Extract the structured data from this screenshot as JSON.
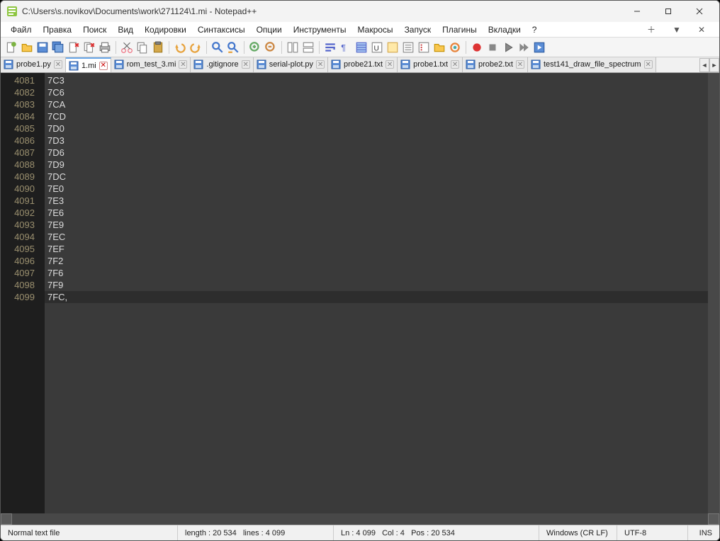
{
  "title": "C:\\Users\\s.novikov\\Documents\\work\\271124\\1.mi - Notepad++",
  "menu": {
    "file": "Файл",
    "edit": "Правка",
    "search": "Поиск",
    "view": "Вид",
    "encoding": "Кодировки",
    "syntax": "Синтаксисы",
    "settings": "Опции",
    "tools": "Инструменты",
    "macros": "Макросы",
    "run": "Запуск",
    "plugins": "Плагины",
    "tabs": "Вкладки",
    "help": "?"
  },
  "tabs": [
    {
      "label": "probe1.py"
    },
    {
      "label": "1.mi"
    },
    {
      "label": "rom_test_3.mi"
    },
    {
      "label": ".gitignore"
    },
    {
      "label": "serial-plot.py"
    },
    {
      "label": "probe21.txt"
    },
    {
      "label": "probe1.txt"
    },
    {
      "label": "probe2.txt"
    },
    {
      "label": "test141_draw_file_spectrum"
    }
  ],
  "active_tab_index": 1,
  "lines": [
    {
      "n": "4081",
      "t": "7C3"
    },
    {
      "n": "4082",
      "t": "7C6"
    },
    {
      "n": "4083",
      "t": "7CA"
    },
    {
      "n": "4084",
      "t": "7CD"
    },
    {
      "n": "4085",
      "t": "7D0"
    },
    {
      "n": "4086",
      "t": "7D3"
    },
    {
      "n": "4087",
      "t": "7D6"
    },
    {
      "n": "4088",
      "t": "7D9"
    },
    {
      "n": "4089",
      "t": "7DC"
    },
    {
      "n": "4090",
      "t": "7E0"
    },
    {
      "n": "4091",
      "t": "7E3"
    },
    {
      "n": "4092",
      "t": "7E6"
    },
    {
      "n": "4093",
      "t": "7E9"
    },
    {
      "n": "4094",
      "t": "7EC"
    },
    {
      "n": "4095",
      "t": "7EF"
    },
    {
      "n": "4096",
      "t": "7F2"
    },
    {
      "n": "4097",
      "t": "7F6"
    },
    {
      "n": "4098",
      "t": "7F9"
    },
    {
      "n": "4099",
      "t": "7FC,"
    }
  ],
  "current_line_index": 18,
  "status": {
    "filetype": "Normal text file",
    "length_label": "length : 20 534",
    "lines_label": "lines : 4 099",
    "ln_label": "Ln : 4 099",
    "col_label": "Col : 4",
    "pos_label": "Pos : 20 534",
    "eol": "Windows (CR LF)",
    "encoding": "UTF-8",
    "ins": "INS"
  }
}
